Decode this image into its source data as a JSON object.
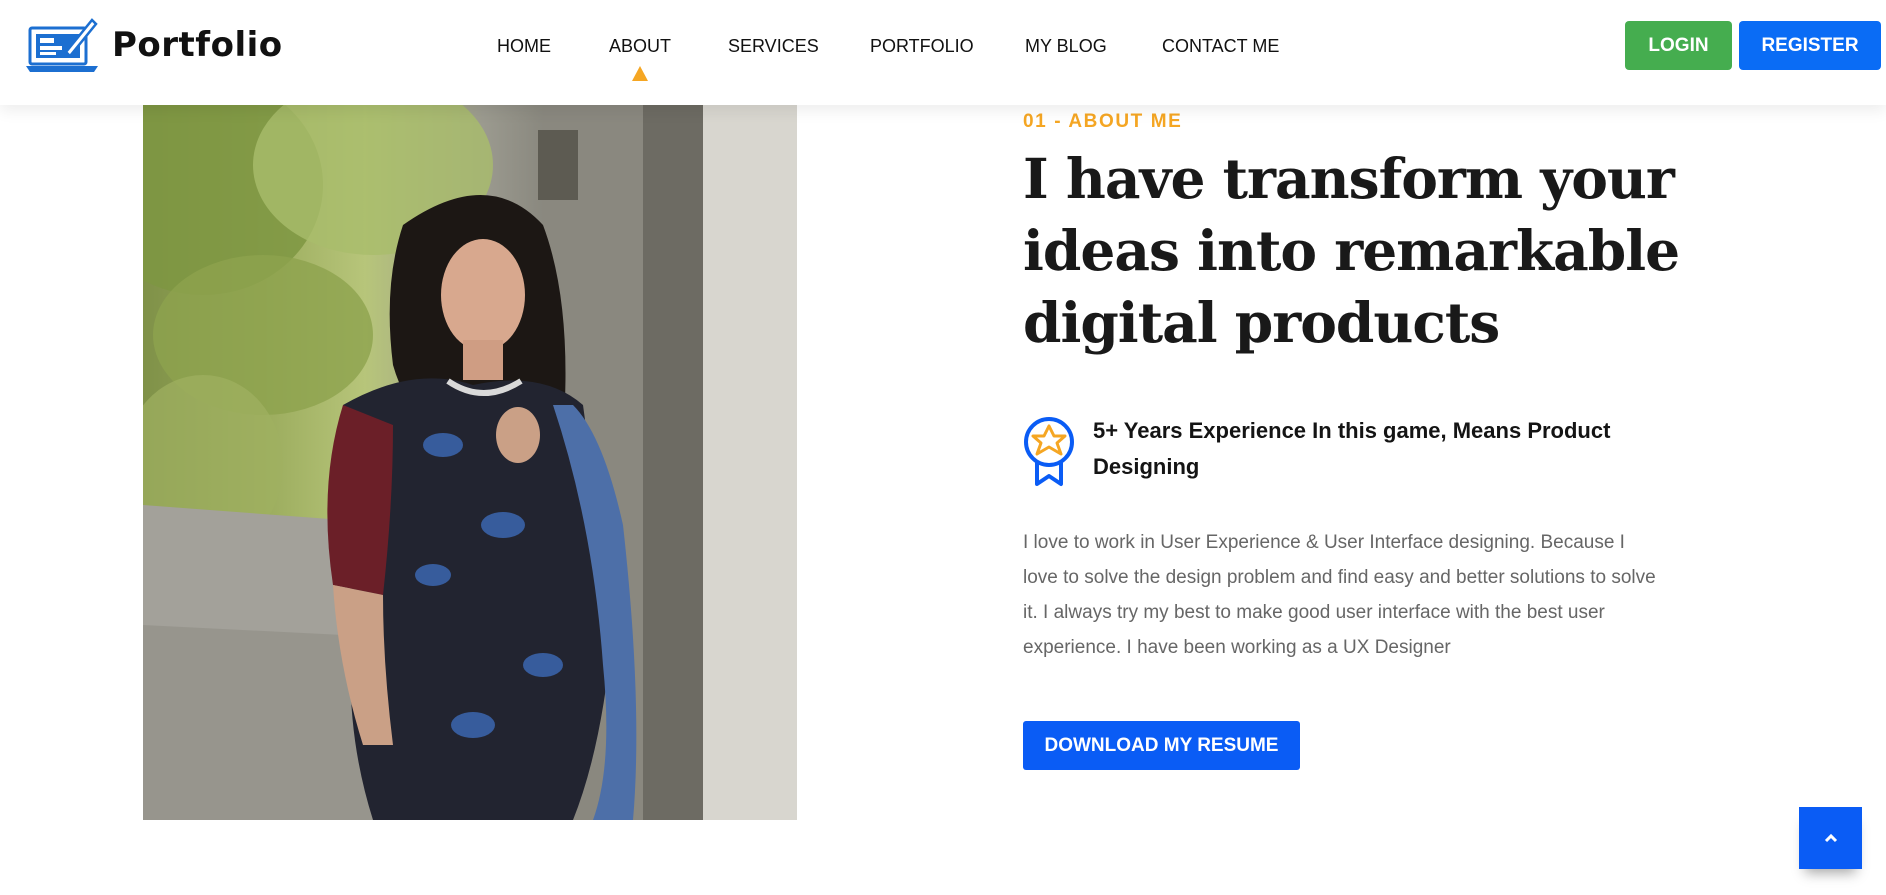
{
  "brand": {
    "name": "Portfolio",
    "logo_icon": "laptop-pen-icon"
  },
  "nav": {
    "items": [
      {
        "label": "HOME"
      },
      {
        "label": "ABOUT",
        "active": true
      },
      {
        "label": "SERVICES"
      },
      {
        "label": "PORTFOLIO"
      },
      {
        "label": "MY BLOG"
      },
      {
        "label": "CONTACT ME"
      }
    ]
  },
  "auth": {
    "login_label": "LOGIN",
    "register_label": "REGISTER"
  },
  "about": {
    "eyebrow": "01 - ABOUT ME",
    "headline": "I have transform your ideas into remarkable digital products",
    "experience": {
      "icon": "award-badge-icon",
      "text": "5+ Years Experience In this game, Means Product Designing"
    },
    "description": "I love to work in User Experience & User Interface designing. Because I love to solve the design problem and find easy and better solutions to solve it. I always try my best to make good user interface with the best user experience. I have been working as a UX Designer",
    "resume_button": "DOWNLOAD MY RESUME"
  },
  "photo": {
    "description_icon": "profile-photo"
  },
  "scroll_top": {
    "icon": "chevron-up-icon"
  },
  "colors": {
    "accent": "#f5a623",
    "primary": "#0a5cf5",
    "register": "#0a6cf5",
    "login": "#45ad4f",
    "heading": "#191919",
    "body_text": "#666666"
  }
}
